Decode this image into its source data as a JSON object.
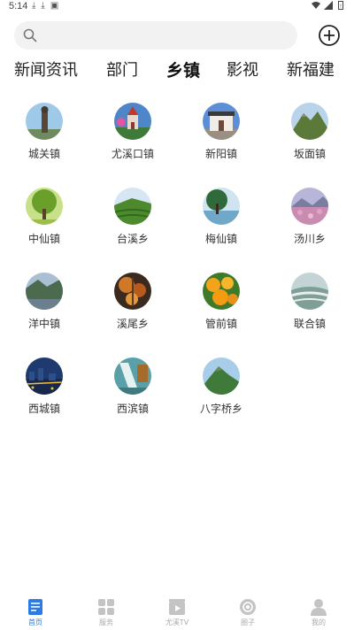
{
  "status_bar": {
    "time": "5:14"
  },
  "search": {
    "placeholder": ""
  },
  "tabs": [
    {
      "label": "新闻资讯",
      "active": false
    },
    {
      "label": "部门",
      "active": false
    },
    {
      "label": "乡镇",
      "active": true
    },
    {
      "label": "影视",
      "active": false
    },
    {
      "label": "新福建",
      "active": false
    }
  ],
  "towns": [
    {
      "label": "城关镇",
      "icon": "statue-photo"
    },
    {
      "label": "尤溪口镇",
      "icon": "church-photo"
    },
    {
      "label": "新阳镇",
      "icon": "gate-photo"
    },
    {
      "label": "坂面镇",
      "icon": "mountain-photo"
    },
    {
      "label": "中仙镇",
      "icon": "tree-photo"
    },
    {
      "label": "台溪乡",
      "icon": "tea-field-photo"
    },
    {
      "label": "梅仙镇",
      "icon": "lake-tree-photo"
    },
    {
      "label": "汤川乡",
      "icon": "flower-field-photo"
    },
    {
      "label": "洋中镇",
      "icon": "valley-photo"
    },
    {
      "label": "溪尾乡",
      "icon": "autumn-leaves-photo"
    },
    {
      "label": "管前镇",
      "icon": "oranges-photo"
    },
    {
      "label": "联合镇",
      "icon": "misty-terraces-photo"
    },
    {
      "label": "西城镇",
      "icon": "night-city-photo"
    },
    {
      "label": "西滨镇",
      "icon": "waterfall-photo"
    },
    {
      "label": "八字桥乡",
      "icon": "green-hill-photo"
    }
  ],
  "bottom_nav": [
    {
      "label": "首页",
      "icon": "news-icon",
      "active": true
    },
    {
      "label": "服务",
      "icon": "grid-icon",
      "active": false
    },
    {
      "label": "尤溪TV",
      "icon": "video-icon",
      "active": false
    },
    {
      "label": "圈子",
      "icon": "circle-icon",
      "active": false
    },
    {
      "label": "我的",
      "icon": "user-icon",
      "active": false
    }
  ],
  "colors": {
    "accent": "#2f7be6",
    "inactive": "#aaaaaa",
    "search_bg": "#f2f2f2"
  }
}
